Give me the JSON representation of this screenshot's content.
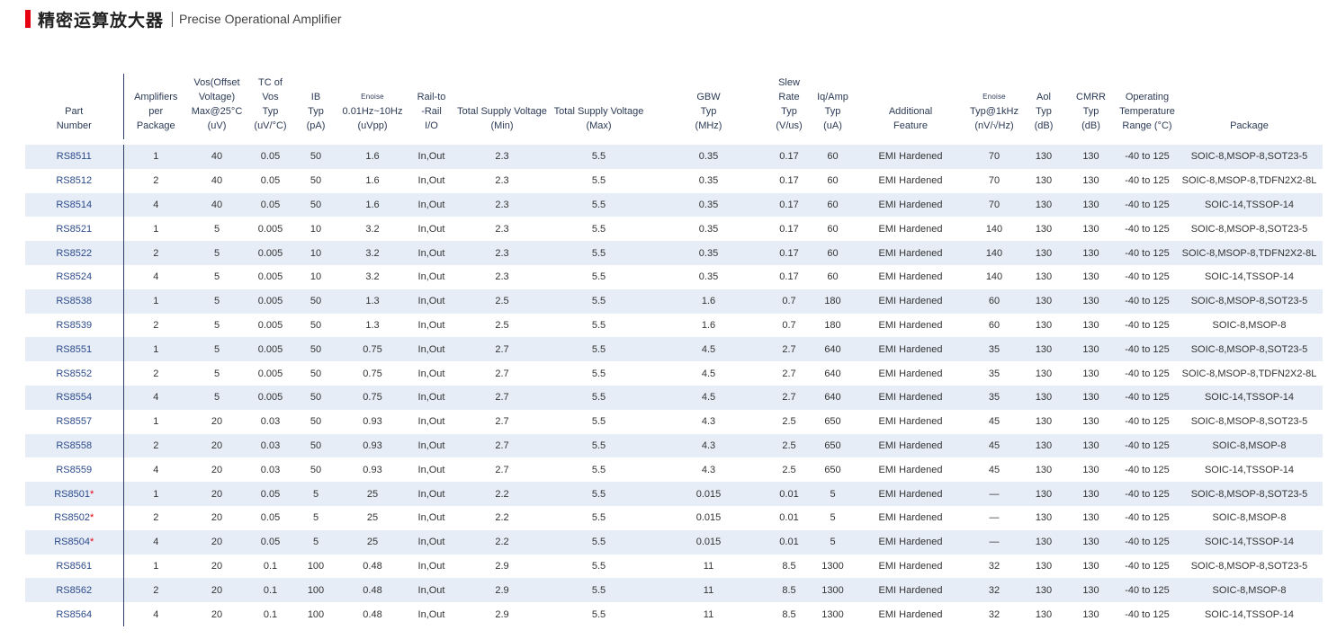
{
  "header": {
    "title_cn": "精密运算放大器",
    "title_en": "Precise Operational Amplifier",
    "accent_color": "#e60012"
  },
  "columns": [
    {
      "key": "part",
      "lines": [
        "Part",
        "Number"
      ]
    },
    {
      "key": "amps",
      "lines": [
        "Amplifiers",
        "per",
        "Package"
      ]
    },
    {
      "key": "vos",
      "lines": [
        "Vos(Offset",
        "Voltage)",
        "Max@25°C",
        "(uV)"
      ]
    },
    {
      "key": "tc",
      "lines": [
        "TC of",
        "Vos",
        "Typ",
        "(uV/°C)"
      ]
    },
    {
      "key": "ib",
      "lines": [
        "IB",
        "Typ",
        "(pA)"
      ]
    },
    {
      "key": "enoise",
      "lines": [
        "Enoise",
        "0.01Hz~10Hz",
        "(uVpp)"
      ]
    },
    {
      "key": "rail",
      "lines": [
        "Rail-to",
        "-Rail",
        "I/O"
      ]
    },
    {
      "key": "vmin",
      "lines": [
        "Total Supply Voltage",
        "(Min)"
      ]
    },
    {
      "key": "vmax",
      "lines": [
        "Total Supply Voltage",
        "(Max)"
      ]
    },
    {
      "key": "gbw",
      "lines": [
        "GBW",
        "Typ",
        "(MHz)"
      ]
    },
    {
      "key": "slew",
      "lines": [
        "Slew Rate",
        "Typ",
        "(V/us)"
      ]
    },
    {
      "key": "iq",
      "lines": [
        "Iq/Amp",
        "Typ",
        "(uA)"
      ]
    },
    {
      "key": "feature",
      "lines": [
        "Additional",
        "Feature"
      ]
    },
    {
      "key": "enoise1k",
      "lines": [
        "Enoise",
        "Typ@1kHz",
        "(nV/√Hz)"
      ]
    },
    {
      "key": "aol",
      "lines": [
        "Aol",
        "Typ",
        "(dB)"
      ]
    },
    {
      "key": "cmrr",
      "lines": [
        "CMRR",
        "Typ",
        "(dB)"
      ]
    },
    {
      "key": "temp",
      "lines": [
        "Operating",
        "Temperature",
        "Range (°C)"
      ]
    },
    {
      "key": "pkg",
      "lines": [
        "Package"
      ]
    }
  ],
  "rows": [
    {
      "part": "RS8511",
      "star": "",
      "amps": "1",
      "vos": "40",
      "tc": "0.05",
      "ib": "50",
      "enoise": "1.6",
      "rail": "In,Out",
      "vmin": "2.3",
      "vmax": "5.5",
      "gbw": "0.35",
      "slew": "0.17",
      "iq": "60",
      "feature": "EMI Hardened",
      "enoise1k": "70",
      "aol": "130",
      "cmrr": "130",
      "temp": "-40 to 125",
      "pkg": "SOIC-8,MSOP-8,SOT23-5"
    },
    {
      "part": "RS8512",
      "star": "",
      "amps": "2",
      "vos": "40",
      "tc": "0.05",
      "ib": "50",
      "enoise": "1.6",
      "rail": "In,Out",
      "vmin": "2.3",
      "vmax": "5.5",
      "gbw": "0.35",
      "slew": "0.17",
      "iq": "60",
      "feature": "EMI Hardened",
      "enoise1k": "70",
      "aol": "130",
      "cmrr": "130",
      "temp": "-40 to 125",
      "pkg": "SOIC-8,MSOP-8,TDFN2X2-8L"
    },
    {
      "part": "RS8514",
      "star": "",
      "amps": "4",
      "vos": "40",
      "tc": "0.05",
      "ib": "50",
      "enoise": "1.6",
      "rail": "In,Out",
      "vmin": "2.3",
      "vmax": "5.5",
      "gbw": "0.35",
      "slew": "0.17",
      "iq": "60",
      "feature": "EMI Hardened",
      "enoise1k": "70",
      "aol": "130",
      "cmrr": "130",
      "temp": "-40 to 125",
      "pkg": "SOIC-14,TSSOP-14"
    },
    {
      "part": "RS8521",
      "star": "",
      "amps": "1",
      "vos": "5",
      "tc": "0.005",
      "ib": "10",
      "enoise": "3.2",
      "rail": "In,Out",
      "vmin": "2.3",
      "vmax": "5.5",
      "gbw": "0.35",
      "slew": "0.17",
      "iq": "60",
      "feature": "EMI Hardened",
      "enoise1k": "140",
      "aol": "130",
      "cmrr": "130",
      "temp": "-40 to 125",
      "pkg": "SOIC-8,MSOP-8,SOT23-5"
    },
    {
      "part": "RS8522",
      "star": "",
      "amps": "2",
      "vos": "5",
      "tc": "0.005",
      "ib": "10",
      "enoise": "3.2",
      "rail": "In,Out",
      "vmin": "2.3",
      "vmax": "5.5",
      "gbw": "0.35",
      "slew": "0.17",
      "iq": "60",
      "feature": "EMI Hardened",
      "enoise1k": "140",
      "aol": "130",
      "cmrr": "130",
      "temp": "-40 to 125",
      "pkg": "SOIC-8,MSOP-8,TDFN2X2-8L"
    },
    {
      "part": "RS8524",
      "star": "",
      "amps": "4",
      "vos": "5",
      "tc": "0.005",
      "ib": "10",
      "enoise": "3.2",
      "rail": "In,Out",
      "vmin": "2.3",
      "vmax": "5.5",
      "gbw": "0.35",
      "slew": "0.17",
      "iq": "60",
      "feature": "EMI Hardened",
      "enoise1k": "140",
      "aol": "130",
      "cmrr": "130",
      "temp": "-40 to 125",
      "pkg": "SOIC-14,TSSOP-14"
    },
    {
      "part": "RS8538",
      "star": "",
      "amps": "1",
      "vos": "5",
      "tc": "0.005",
      "ib": "50",
      "enoise": "1.3",
      "rail": "In,Out",
      "vmin": "2.5",
      "vmax": "5.5",
      "gbw": "1.6",
      "slew": "0.7",
      "iq": "180",
      "feature": "EMI Hardened",
      "enoise1k": "60",
      "aol": "130",
      "cmrr": "130",
      "temp": "-40 to 125",
      "pkg": "SOIC-8,MSOP-8,SOT23-5"
    },
    {
      "part": "RS8539",
      "star": "",
      "amps": "2",
      "vos": "5",
      "tc": "0.005",
      "ib": "50",
      "enoise": "1.3",
      "rail": "In,Out",
      "vmin": "2.5",
      "vmax": "5.5",
      "gbw": "1.6",
      "slew": "0.7",
      "iq": "180",
      "feature": "EMI Hardened",
      "enoise1k": "60",
      "aol": "130",
      "cmrr": "130",
      "temp": "-40 to 125",
      "pkg": "SOIC-8,MSOP-8"
    },
    {
      "part": "RS8551",
      "star": "",
      "amps": "1",
      "vos": "5",
      "tc": "0.005",
      "ib": "50",
      "enoise": "0.75",
      "rail": "In,Out",
      "vmin": "2.7",
      "vmax": "5.5",
      "gbw": "4.5",
      "slew": "2.7",
      "iq": "640",
      "feature": "EMI Hardened",
      "enoise1k": "35",
      "aol": "130",
      "cmrr": "130",
      "temp": "-40 to 125",
      "pkg": "SOIC-8,MSOP-8,SOT23-5"
    },
    {
      "part": "RS8552",
      "star": "",
      "amps": "2",
      "vos": "5",
      "tc": "0.005",
      "ib": "50",
      "enoise": "0.75",
      "rail": "In,Out",
      "vmin": "2.7",
      "vmax": "5.5",
      "gbw": "4.5",
      "slew": "2.7",
      "iq": "640",
      "feature": "EMI Hardened",
      "enoise1k": "35",
      "aol": "130",
      "cmrr": "130",
      "temp": "-40 to 125",
      "pkg": "SOIC-8,MSOP-8,TDFN2X2-8L"
    },
    {
      "part": "RS8554",
      "star": "",
      "amps": "4",
      "vos": "5",
      "tc": "0.005",
      "ib": "50",
      "enoise": "0.75",
      "rail": "In,Out",
      "vmin": "2.7",
      "vmax": "5.5",
      "gbw": "4.5",
      "slew": "2.7",
      "iq": "640",
      "feature": "EMI Hardened",
      "enoise1k": "35",
      "aol": "130",
      "cmrr": "130",
      "temp": "-40 to 125",
      "pkg": "SOIC-14,TSSOP-14"
    },
    {
      "part": "RS8557",
      "star": "",
      "amps": "1",
      "vos": "20",
      "tc": "0.03",
      "ib": "50",
      "enoise": "0.93",
      "rail": "In,Out",
      "vmin": "2.7",
      "vmax": "5.5",
      "gbw": "4.3",
      "slew": "2.5",
      "iq": "650",
      "feature": "EMI Hardened",
      "enoise1k": "45",
      "aol": "130",
      "cmrr": "130",
      "temp": "-40 to 125",
      "pkg": "SOIC-8,MSOP-8,SOT23-5"
    },
    {
      "part": "RS8558",
      "star": "",
      "amps": "2",
      "vos": "20",
      "tc": "0.03",
      "ib": "50",
      "enoise": "0.93",
      "rail": "In,Out",
      "vmin": "2.7",
      "vmax": "5.5",
      "gbw": "4.3",
      "slew": "2.5",
      "iq": "650",
      "feature": "EMI Hardened",
      "enoise1k": "45",
      "aol": "130",
      "cmrr": "130",
      "temp": "-40 to 125",
      "pkg": "SOIC-8,MSOP-8"
    },
    {
      "part": "RS8559",
      "star": "",
      "amps": "4",
      "vos": "20",
      "tc": "0.03",
      "ib": "50",
      "enoise": "0.93",
      "rail": "In,Out",
      "vmin": "2.7",
      "vmax": "5.5",
      "gbw": "4.3",
      "slew": "2.5",
      "iq": "650",
      "feature": "EMI Hardened",
      "enoise1k": "45",
      "aol": "130",
      "cmrr": "130",
      "temp": "-40 to 125",
      "pkg": "SOIC-14,TSSOP-14"
    },
    {
      "part": "RS8501",
      "star": "*",
      "amps": "1",
      "vos": "20",
      "tc": "0.05",
      "ib": "5",
      "enoise": "25",
      "rail": "In,Out",
      "vmin": "2.2",
      "vmax": "5.5",
      "gbw": "0.015",
      "slew": "0.01",
      "iq": "5",
      "feature": "EMI Hardened",
      "enoise1k": "—",
      "aol": "130",
      "cmrr": "130",
      "temp": "-40 to 125",
      "pkg": "SOIC-8,MSOP-8,SOT23-5"
    },
    {
      "part": "RS8502",
      "star": "*",
      "amps": "2",
      "vos": "20",
      "tc": "0.05",
      "ib": "5",
      "enoise": "25",
      "rail": "In,Out",
      "vmin": "2.2",
      "vmax": "5.5",
      "gbw": "0.015",
      "slew": "0.01",
      "iq": "5",
      "feature": "EMI Hardened",
      "enoise1k": "—",
      "aol": "130",
      "cmrr": "130",
      "temp": "-40 to 125",
      "pkg": "SOIC-8,MSOP-8"
    },
    {
      "part": "RS8504",
      "star": "*",
      "amps": "4",
      "vos": "20",
      "tc": "0.05",
      "ib": "5",
      "enoise": "25",
      "rail": "In,Out",
      "vmin": "2.2",
      "vmax": "5.5",
      "gbw": "0.015",
      "slew": "0.01",
      "iq": "5",
      "feature": "EMI Hardened",
      "enoise1k": "—",
      "aol": "130",
      "cmrr": "130",
      "temp": "-40 to 125",
      "pkg": "SOIC-14,TSSOP-14"
    },
    {
      "part": "RS8561",
      "star": "",
      "amps": "1",
      "vos": "20",
      "tc": "0.1",
      "ib": "100",
      "enoise": "0.48",
      "rail": "In,Out",
      "vmin": "2.9",
      "vmax": "5.5",
      "gbw": "11",
      "slew": "8.5",
      "iq": "1300",
      "feature": "EMI Hardened",
      "enoise1k": "32",
      "aol": "130",
      "cmrr": "130",
      "temp": "-40 to 125",
      "pkg": "SOIC-8,MSOP-8,SOT23-5"
    },
    {
      "part": "RS8562",
      "star": "",
      "amps": "2",
      "vos": "20",
      "tc": "0.1",
      "ib": "100",
      "enoise": "0.48",
      "rail": "In,Out",
      "vmin": "2.9",
      "vmax": "5.5",
      "gbw": "11",
      "slew": "8.5",
      "iq": "1300",
      "feature": "EMI Hardened",
      "enoise1k": "32",
      "aol": "130",
      "cmrr": "130",
      "temp": "-40 to 125",
      "pkg": "SOIC-8,MSOP-8"
    },
    {
      "part": "RS8564",
      "star": "",
      "amps": "4",
      "vos": "20",
      "tc": "0.1",
      "ib": "100",
      "enoise": "0.48",
      "rail": "In,Out",
      "vmin": "2.9",
      "vmax": "5.5",
      "gbw": "11",
      "slew": "8.5",
      "iq": "1300",
      "feature": "EMI Hardened",
      "enoise1k": "32",
      "aol": "130",
      "cmrr": "130",
      "temp": "-40 to 125",
      "pkg": "SOIC-14,TSSOP-14"
    }
  ]
}
